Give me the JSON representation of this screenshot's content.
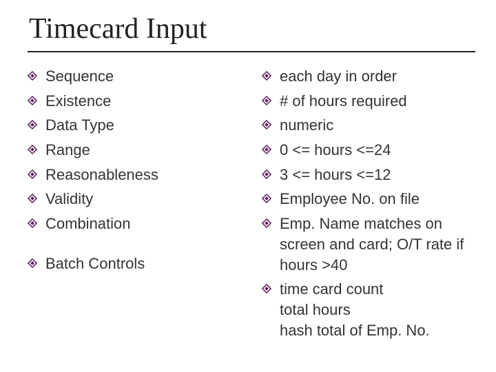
{
  "title": "Timecard Input",
  "bullet_color": "#5a1f5a",
  "left": [
    "Sequence",
    "Existence",
    "Data Type",
    "Range",
    "Reasonableness",
    "Validity",
    "Combination"
  ],
  "left_after_gap": [
    "Batch Controls"
  ],
  "right": [
    "each day in order",
    "# of hours required",
    "numeric",
    "0 <= hours <=24",
    "3 <= hours <=12",
    "Employee No. on file",
    "Emp. Name matches on screen and card; O/T rate if hours >40",
    "time card count\ntotal hours\nhash total of Emp. No."
  ]
}
